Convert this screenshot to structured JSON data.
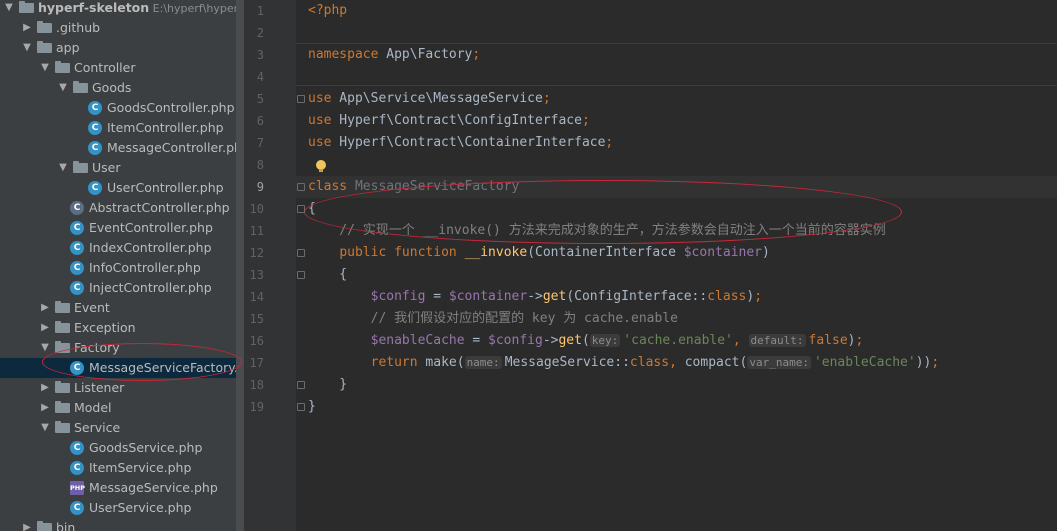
{
  "project_tree": {
    "root": {
      "name": "hyperf-skeleton",
      "path": "E:\\hyperf\\hyperf-s"
    },
    "items": [
      {
        "label": ".github",
        "type": "folder",
        "depth": 1,
        "state": "collapsed"
      },
      {
        "label": "app",
        "type": "folder",
        "depth": 1,
        "state": "expanded"
      },
      {
        "label": "Controller",
        "type": "folder",
        "depth": 2,
        "state": "expanded"
      },
      {
        "label": "Goods",
        "type": "folder",
        "depth": 3,
        "state": "expanded"
      },
      {
        "label": "GoodsController.php",
        "type": "class",
        "depth": 4
      },
      {
        "label": "ItemController.php",
        "type": "class",
        "depth": 4
      },
      {
        "label": "MessageController.php",
        "type": "class",
        "depth": 4
      },
      {
        "label": "User",
        "type": "folder",
        "depth": 3,
        "state": "expanded"
      },
      {
        "label": "UserController.php",
        "type": "class",
        "depth": 4
      },
      {
        "label": "AbstractController.php",
        "type": "abstract",
        "depth": 3
      },
      {
        "label": "EventController.php",
        "type": "class",
        "depth": 3
      },
      {
        "label": "IndexController.php",
        "type": "class",
        "depth": 3
      },
      {
        "label": "InfoController.php",
        "type": "class",
        "depth": 3
      },
      {
        "label": "InjectController.php",
        "type": "class",
        "depth": 3
      },
      {
        "label": "Event",
        "type": "folder",
        "depth": 2,
        "state": "collapsed"
      },
      {
        "label": "Exception",
        "type": "folder",
        "depth": 2,
        "state": "collapsed"
      },
      {
        "label": "Factory",
        "type": "folder",
        "depth": 2,
        "state": "expanded"
      },
      {
        "label": "MessageServiceFactory.php",
        "type": "class",
        "depth": 3,
        "selected": true
      },
      {
        "label": "Listener",
        "type": "folder",
        "depth": 2,
        "state": "collapsed"
      },
      {
        "label": "Model",
        "type": "folder",
        "depth": 2,
        "state": "collapsed"
      },
      {
        "label": "Service",
        "type": "folder",
        "depth": 2,
        "state": "expanded"
      },
      {
        "label": "GoodsService.php",
        "type": "class",
        "depth": 3
      },
      {
        "label": "ItemService.php",
        "type": "class",
        "depth": 3
      },
      {
        "label": "MessageService.php",
        "type": "php",
        "depth": 3
      },
      {
        "label": "UserService.php",
        "type": "class",
        "depth": 3
      },
      {
        "label": "bin",
        "type": "folder",
        "depth": 1,
        "state": "collapsed"
      }
    ]
  },
  "php_icon_text": "PHP",
  "class_icon_text": "C",
  "editor": {
    "current_line": 9,
    "lines": [
      {
        "n": "1",
        "tokens": [
          {
            "t": "<?php",
            "c": "kw"
          }
        ]
      },
      {
        "n": "2",
        "tokens": []
      },
      {
        "n": "3",
        "tokens": [
          {
            "t": "namespace",
            "c": "kw"
          },
          {
            "t": " App\\Factory",
            "c": ""
          },
          {
            "t": ";",
            "c": "kw"
          }
        ]
      },
      {
        "n": "4",
        "tokens": []
      },
      {
        "n": "5",
        "tokens": [
          {
            "t": "use",
            "c": "kw"
          },
          {
            "t": " App\\Service\\MessageService",
            "c": ""
          },
          {
            "t": ";",
            "c": "kw"
          }
        ]
      },
      {
        "n": "6",
        "tokens": [
          {
            "t": "use",
            "c": "kw"
          },
          {
            "t": " Hyperf\\Contract\\ConfigInterface",
            "c": ""
          },
          {
            "t": ";",
            "c": "kw"
          }
        ]
      },
      {
        "n": "7",
        "tokens": [
          {
            "t": "use",
            "c": "kw"
          },
          {
            "t": " Hyperf\\Contract\\ContainerInterface",
            "c": ""
          },
          {
            "t": ";",
            "c": "kw"
          }
        ]
      },
      {
        "n": "8",
        "tokens": []
      },
      {
        "n": "9",
        "tokens": [
          {
            "t": "class",
            "c": "kw"
          },
          {
            "t": " ",
            "c": ""
          },
          {
            "t": "MessageServiceFactory",
            "c": "ghost"
          }
        ]
      },
      {
        "n": "10",
        "tokens": [
          {
            "t": "{",
            "c": ""
          }
        ]
      },
      {
        "n": "11",
        "tokens": [
          {
            "t": "    // 实现一个 __invoke() 方法来完成对象的生产，方法参数会自动注入一个当前的容器实例",
            "c": "cm"
          }
        ]
      },
      {
        "n": "12",
        "tokens": [
          {
            "t": "    ",
            "c": ""
          },
          {
            "t": "public",
            "c": "kw"
          },
          {
            "t": " ",
            "c": ""
          },
          {
            "t": "function",
            "c": "kw"
          },
          {
            "t": " ",
            "c": ""
          },
          {
            "t": "__invoke",
            "c": "fn"
          },
          {
            "t": "(ContainerInterface ",
            "c": ""
          },
          {
            "t": "$container",
            "c": "var"
          },
          {
            "t": ")",
            "c": ""
          }
        ]
      },
      {
        "n": "13",
        "tokens": [
          {
            "t": "    {",
            "c": ""
          }
        ]
      },
      {
        "n": "14",
        "tokens": [
          {
            "t": "        ",
            "c": ""
          },
          {
            "t": "$config",
            "c": "var"
          },
          {
            "t": " = ",
            "c": ""
          },
          {
            "t": "$container",
            "c": "var"
          },
          {
            "t": "->",
            "c": ""
          },
          {
            "t": "get",
            "c": "fn"
          },
          {
            "t": "(ConfigInterface::",
            "c": ""
          },
          {
            "t": "class",
            "c": "kw"
          },
          {
            "t": ")",
            "c": ""
          },
          {
            "t": ";",
            "c": "kw"
          }
        ]
      },
      {
        "n": "15",
        "tokens": [
          {
            "t": "        // 我们假设对应的配置的 key 为 cache.enable",
            "c": "cm"
          }
        ]
      },
      {
        "n": "16",
        "tokens": [
          {
            "t": "        ",
            "c": ""
          },
          {
            "t": "$enableCache",
            "c": "var"
          },
          {
            "t": " = ",
            "c": ""
          },
          {
            "t": "$config",
            "c": "var"
          },
          {
            "t": "->",
            "c": ""
          },
          {
            "t": "get",
            "c": "fn"
          },
          {
            "t": "(",
            "c": ""
          },
          {
            "t": "key:",
            "c": "hint"
          },
          {
            "t": "'cache.enable'",
            "c": "str"
          },
          {
            "t": ", ",
            "c": "kw"
          },
          {
            "t": "default:",
            "c": "hint"
          },
          {
            "t": "false",
            "c": "kw"
          },
          {
            "t": ")",
            "c": ""
          },
          {
            "t": ";",
            "c": "kw"
          }
        ]
      },
      {
        "n": "17",
        "tokens": [
          {
            "t": "        ",
            "c": ""
          },
          {
            "t": "return",
            "c": "kw"
          },
          {
            "t": " make(",
            "c": ""
          },
          {
            "t": "name:",
            "c": "hint"
          },
          {
            "t": "MessageService::",
            "c": ""
          },
          {
            "t": "class",
            "c": "kw"
          },
          {
            "t": ", ",
            "c": "kw"
          },
          {
            "t": "compact(",
            "c": ""
          },
          {
            "t": "var_name:",
            "c": "hint"
          },
          {
            "t": "'enableCache'",
            "c": "str"
          },
          {
            "t": "))",
            "c": ""
          },
          {
            "t": ";",
            "c": "kw"
          }
        ]
      },
      {
        "n": "18",
        "tokens": [
          {
            "t": "    }",
            "c": ""
          }
        ]
      },
      {
        "n": "19",
        "tokens": [
          {
            "t": "}",
            "c": ""
          }
        ]
      }
    ]
  }
}
